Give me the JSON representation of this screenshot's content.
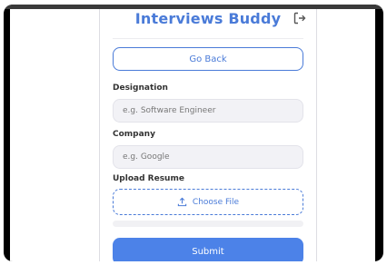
{
  "app": {
    "title": "Interviews Buddy",
    "back_label": "Go Back"
  },
  "form": {
    "designation": {
      "label": "Designation",
      "placeholder": "e.g. Software Engineer"
    },
    "company": {
      "label": "Company",
      "placeholder": "e.g. Google"
    },
    "resume": {
      "label": "Upload Resume",
      "button": "Choose File"
    },
    "submit_label": "Submit"
  },
  "icons": {
    "logout": "logout-icon",
    "upload": "upload-icon"
  },
  "colors": {
    "accent": "#4a7bd8",
    "submit": "#4c82e8"
  }
}
